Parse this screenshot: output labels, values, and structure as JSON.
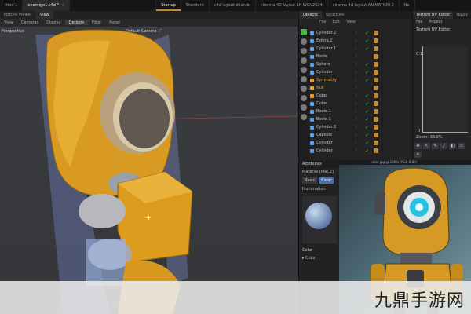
{
  "tabs": [
    {
      "label": "ttled 1",
      "active": false
    },
    {
      "label": "enemigo1.c4d *",
      "active": true
    },
    {
      "label": "",
      "active": false
    },
    {
      "label": "Startup",
      "active": false,
      "highlight": true
    },
    {
      "label": "Standard",
      "active": false
    },
    {
      "label": "c4d layout dilando",
      "active": false
    },
    {
      "label": "cinema 4D layout LH WOV2024",
      "active": false
    },
    {
      "label": "cinema 4d layout ANIMATION 2",
      "active": false
    },
    {
      "label": "Ne",
      "active": false
    }
  ],
  "picture_viewer_tabs": [
    "Picture Viewer",
    "View"
  ],
  "viewport_menu": [
    "View",
    "Cameras",
    "Display",
    "Options",
    "Filter",
    "Panel"
  ],
  "viewport_menu_selected": "Options",
  "viewport": {
    "label_left": "Perspective",
    "label_camera": "Default Camera ∘″"
  },
  "object_panel": {
    "tabs": [
      "Objects",
      "Structure"
    ],
    "menu": [
      "File",
      "Edit",
      "View"
    ],
    "rows": [
      {
        "name": "Cylinder.2",
        "type": "mesh",
        "checked": true
      },
      {
        "name": "Esfera.2",
        "type": "mesh",
        "checked": true
      },
      {
        "name": "Cylinder.1",
        "type": "mesh",
        "checked": true
      },
      {
        "name": "Boole",
        "type": "mesh",
        "checked": false
      },
      {
        "name": "Sphere",
        "type": "mesh",
        "checked": true
      },
      {
        "name": "Cylinder",
        "type": "mesh",
        "checked": true
      },
      {
        "name": "Symmetry",
        "type": "gen",
        "checked": true
      },
      {
        "name": "Null",
        "type": "gen",
        "checked": false
      },
      {
        "name": "Cube",
        "type": "gen",
        "checked": true
      },
      {
        "name": "Cube",
        "type": "mesh",
        "checked": true
      },
      {
        "name": "Boole.1",
        "type": "mesh",
        "checked": true
      },
      {
        "name": "Boole.1",
        "type": "mesh",
        "checked": true
      },
      {
        "name": "Cylinder.3",
        "type": "mesh",
        "checked": true
      },
      {
        "name": "Capsule",
        "type": "mesh",
        "checked": true
      },
      {
        "name": "Cylinder",
        "type": "mesh",
        "checked": true
      },
      {
        "name": "Cylinder",
        "type": "mesh",
        "checked": true
      }
    ]
  },
  "uv_panel": {
    "tabs": [
      "Texture UV Editor",
      "Navig"
    ],
    "menu": [
      "File",
      "Project"
    ],
    "title": "Texture UV Editor",
    "y_tick_top": "0.1",
    "y_tick_bottom": "0",
    "zoom": "Zoom: 33.0%"
  },
  "attributes": {
    "title": "Attributes",
    "material": "Material [Mat.2]",
    "tabs": [
      "Basic",
      "Color"
    ],
    "active_tab": "Color",
    "sub": "Illumination",
    "section": "Color",
    "row": "Color"
  },
  "image_bar": "robot.jpg @ 100% (RGB 8 Bit)",
  "watermark": "九鼎手游网",
  "colors": {
    "accent_orange": "#e8a23c",
    "robot_yellow": "#d69a24",
    "check_green": "#5cc35c",
    "panel_bg": "#232325"
  }
}
